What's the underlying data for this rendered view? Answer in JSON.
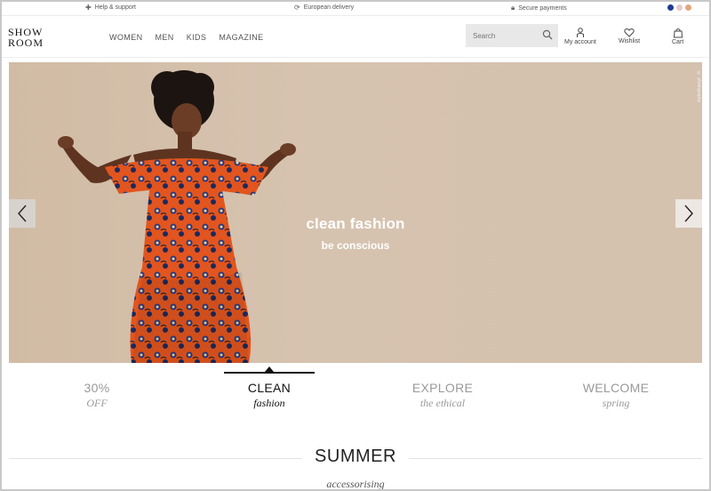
{
  "utility": {
    "help": "Help & support",
    "delivery": "European delivery",
    "payments": "Secure payments"
  },
  "flags": [
    "#1f3a93",
    "#e8c9c9",
    "#e3a67a"
  ],
  "logo": {
    "line1": "SHOW",
    "line2": "ROOM"
  },
  "nav": [
    "WOMEN",
    "MEN",
    "KIDS",
    "MAGAZINE"
  ],
  "search": {
    "placeholder": "Search"
  },
  "header_actions": {
    "account": "My account",
    "wishlist": "Wishlist",
    "cart": "Cart"
  },
  "hero": {
    "title": "clean fashion",
    "subtitle": "be conscious",
    "credit": "© photography"
  },
  "tabs": [
    {
      "head": "30%",
      "sub": "OFF"
    },
    {
      "head": "CLEAN",
      "sub": "fashion"
    },
    {
      "head": "EXPLORE",
      "sub": "the ethical"
    },
    {
      "head": "WELCOME",
      "sub": "spring"
    }
  ],
  "active_tab": 1,
  "section": {
    "title": "SUMMER",
    "subtitle": "accessorising"
  }
}
